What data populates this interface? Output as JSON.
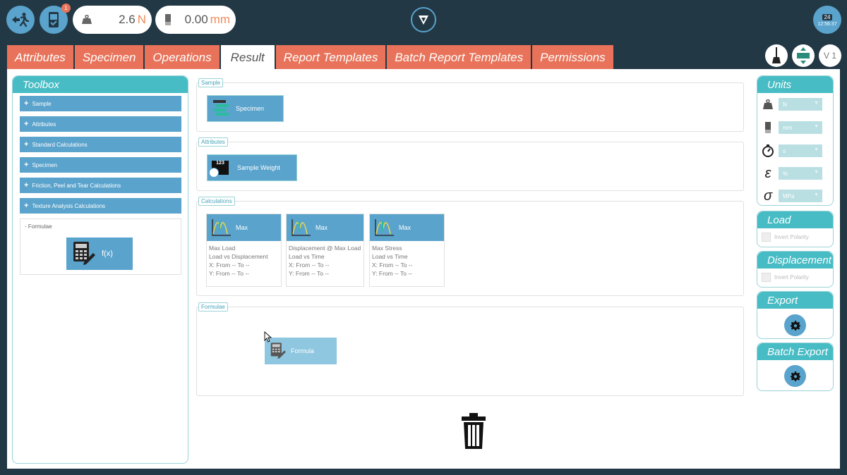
{
  "topbar": {
    "notification_count": "1",
    "load_value": "2.6",
    "load_unit": "N",
    "disp_value": "0.00",
    "disp_unit": "mm",
    "clock_day": "24",
    "clock_time": "12:56:37"
  },
  "tabs": [
    {
      "label": "Attributes"
    },
    {
      "label": "Specimen"
    },
    {
      "label": "Operations"
    },
    {
      "label": "Result"
    },
    {
      "label": "Report Templates"
    },
    {
      "label": "Batch Report Templates"
    },
    {
      "label": "Permissions"
    }
  ],
  "version_label": "V 1",
  "toolbox": {
    "title": "Toolbox",
    "items": [
      {
        "label": "Sample"
      },
      {
        "label": "Attributes"
      },
      {
        "label": "Standard Calculations"
      },
      {
        "label": "Specimen"
      },
      {
        "label": "Friction, Peel and Tear Calculations"
      },
      {
        "label": "Texture Analysis Calculations"
      }
    ],
    "formulae_label": "Formulae",
    "formulae_tile_label": "f(x)"
  },
  "sections": {
    "sample": {
      "legend": "Sample",
      "tile_label": "Specimen"
    },
    "attributes": {
      "legend": "Attributes",
      "tile_label": "Sample Weight",
      "tile_icon_text": "123"
    },
    "calculations": {
      "legend": "Calculations",
      "cards": [
        {
          "title": "Max",
          "lines": [
            "Max Load",
            "Load vs Displacement",
            "X: From -- To --",
            "Y: From -- To --"
          ]
        },
        {
          "title": "Max",
          "lines": [
            "Displacement @ Max Load",
            "Load vs Time",
            "X: From -- To --",
            "Y: From -- To --"
          ]
        },
        {
          "title": "Max",
          "lines": [
            "Max Stress",
            "Load vs Time",
            "X: From -- To --",
            "Y: From -- To --"
          ]
        }
      ]
    },
    "formulae": {
      "legend": "Formulae",
      "tile_label": "Formula"
    }
  },
  "units": {
    "title": "Units",
    "rows": [
      {
        "icon": "weight-icon",
        "value": "N"
      },
      {
        "icon": "length-icon",
        "value": "mm"
      },
      {
        "icon": "stopwatch-icon",
        "value": "s"
      },
      {
        "icon": "epsilon-icon",
        "symbol": "ε",
        "value": "%"
      },
      {
        "icon": "sigma-icon",
        "symbol": "σ",
        "value": "MPa"
      }
    ]
  },
  "load": {
    "title": "Load",
    "checkbox_label": "Invert Polarity"
  },
  "displacement": {
    "title": "Displacement",
    "checkbox_label": "Invert Polarity"
  },
  "export": {
    "title": "Export"
  },
  "batch_export": {
    "title": "Batch Export"
  }
}
